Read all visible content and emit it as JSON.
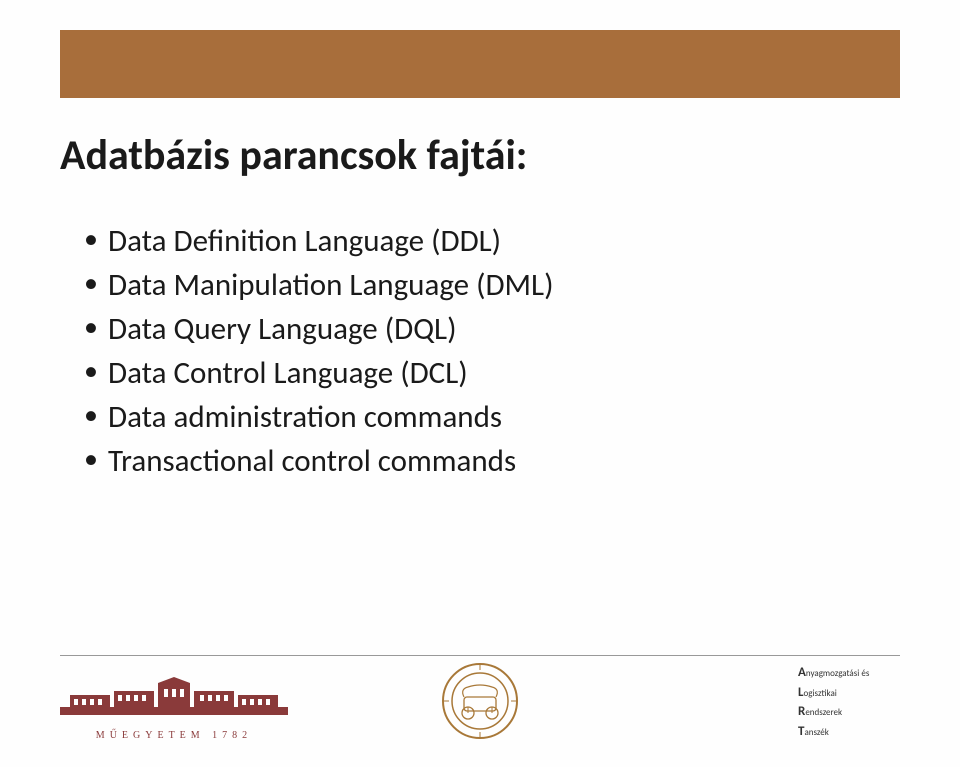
{
  "title": "Adatbázis parancsok fajtái:",
  "bullets": [
    "Data Definition Language (DDL)",
    "Data Manipulation Language (DML)",
    "Data Query Language (DQL)",
    "Data Control Language (DCL)",
    "Data administration commands",
    "Transactional control commands"
  ],
  "footer": {
    "left_caption": "MŰEGYETEM 1782",
    "right_lines": [
      {
        "big": "A",
        "rest": "nyagmozgatási és"
      },
      {
        "big": "L",
        "rest": "ogisztikai"
      },
      {
        "big": "R",
        "rest": "endszerek"
      },
      {
        "big": "T",
        "rest": "anszék"
      }
    ]
  }
}
